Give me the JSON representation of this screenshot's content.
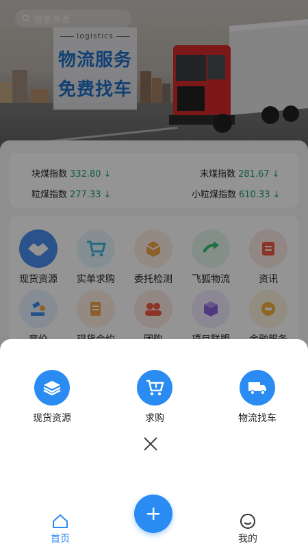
{
  "banner": {
    "search_placeholder": "搜索资源",
    "promo_sub": "logistics",
    "promo_line1": "物流服务",
    "promo_line2": "免费找车"
  },
  "indices": [
    {
      "name": "块煤指数",
      "value": "332.80",
      "arrow": "↓"
    },
    {
      "name": "末煤指数",
      "value": "281.67",
      "arrow": "↓"
    },
    {
      "name": "粒煤指数",
      "value": "277.33",
      "arrow": "↓"
    },
    {
      "name": "小粒煤指数",
      "value": "610.33",
      "arrow": "↓"
    }
  ],
  "grid": [
    {
      "label": "现货资源",
      "icon": "handshake-icon",
      "color": "#4a8ef0"
    },
    {
      "label": "实单求购",
      "icon": "cart-icon",
      "color": "#8fd3e8"
    },
    {
      "label": "委托检测",
      "icon": "package-icon",
      "color": "#f6c890"
    },
    {
      "label": "飞狐物流",
      "icon": "refresh-arrow-icon",
      "color": "#8fe0b4"
    },
    {
      "label": "资讯",
      "icon": "news-icon",
      "color": "#f59a8a"
    },
    {
      "label": "竞价",
      "icon": "auction-icon",
      "color": "#8fc4f0"
    },
    {
      "label": "现货合约",
      "icon": "contract-icon",
      "color": "#f6c890"
    },
    {
      "label": "团购",
      "icon": "group-icon",
      "color": "#f59a8a"
    },
    {
      "label": "项目联盟",
      "icon": "cube-icon",
      "color": "#b89af0"
    },
    {
      "label": "金融服务",
      "icon": "coin-icon",
      "color": "#f6c870"
    }
  ],
  "sheet": {
    "actions": [
      {
        "label": "现货资源",
        "icon": "layers-icon"
      },
      {
        "label": "求购",
        "icon": "cart-icon"
      },
      {
        "label": "物流找车",
        "icon": "truck-icon"
      }
    ]
  },
  "nav": {
    "home": "首页",
    "mine": "我的"
  },
  "colors": {
    "accent": "#2a8bf2",
    "index_value": "#1a9f6a"
  }
}
